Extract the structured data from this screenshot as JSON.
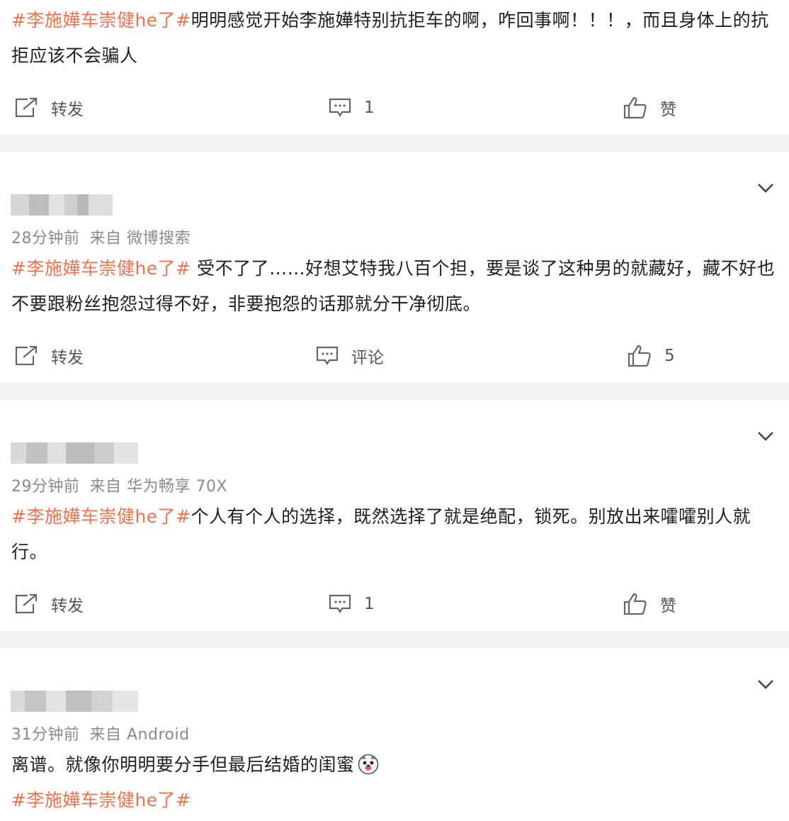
{
  "posts": [
    {
      "hashtag": "#李施嬅车崇健he了#",
      "body": "明明感觉开始李施嬅特别抗拒车的啊，咋回事啊！！！，而且身体上的抗拒应该不会骗人",
      "repost_label": "转发",
      "comment_label": "1",
      "like_label": "赞"
    },
    {
      "time": "28分钟前",
      "source": "来自 微博搜索",
      "hashtag": "#李施嬅车崇健he了#",
      "body": " 受不了了……好想艾特我八百个担，要是谈了这种男的就藏好，藏不好也不要跟粉丝抱怨过得不好，非要抱怨的话那就分干净彻底。",
      "repost_label": "转发",
      "comment_label": "评论",
      "like_label": "5"
    },
    {
      "time": "29分钟前",
      "source": "来自 华为畅享 70X",
      "hashtag": "#李施嬅车崇健he了#",
      "body": "个人有个人的选择，既然选择了就是绝配，锁死。别放出来嚯嚯别人就行。",
      "repost_label": "转发",
      "comment_label": "1",
      "like_label": "赞"
    },
    {
      "time": "31分钟前",
      "source": "来自 Android",
      "body": "离谱。就像你明明要分手但最后结婚的闺蜜",
      "emoji": "doge-face-icon",
      "hashtag": "#李施嬅车崇健he了#"
    }
  ],
  "colors": {
    "hashtag": "#eb7350",
    "meta": "#8a8a8a",
    "separator": "#f2f2f2"
  },
  "icons": {
    "repost": "repost-icon",
    "comment": "comment-icon",
    "like": "thumbs-up-icon",
    "menu": "chevron-down-icon"
  }
}
